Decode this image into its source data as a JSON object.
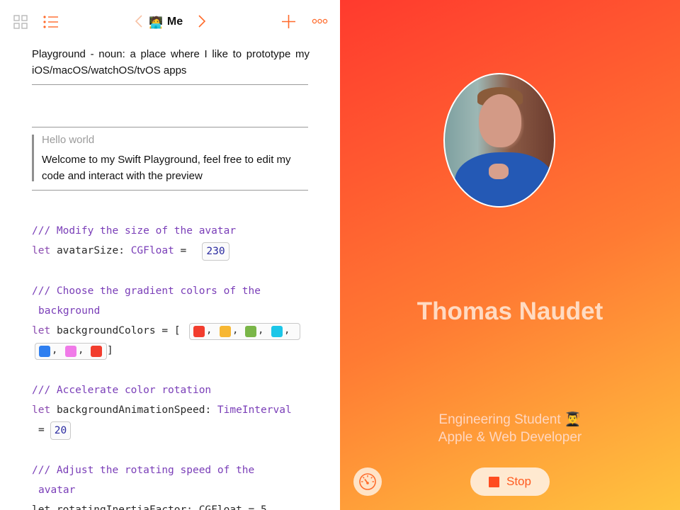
{
  "toolbar": {
    "title_emoji": "🧑‍💻",
    "title": "Me",
    "icons": [
      "grid-icon",
      "list-icon",
      "chevron-left-icon",
      "chevron-right-icon",
      "plus-icon",
      "more-icon"
    ],
    "accent": "#ff6a2a"
  },
  "doc": {
    "intro": "Playground - noun: a place where I like to prototype my iOS/macOS/watchOS/tvOS apps",
    "quote_title": "Hello world",
    "quote_body": "Welcome to my Swift Playground, feel free to edit my code and interact with the preview"
  },
  "code": {
    "kw_let": "let",
    "eq": "=",
    "comment1": "/// Modify the size of the avatar",
    "line1_name": "avatarSize:",
    "line1_type": "CGFloat",
    "line1_value": "230",
    "comment2a": "/// Choose the gradient colors of the",
    "comment2b": "background",
    "line2_name": "backgroundColors",
    "line2_open": "= [",
    "line2_close": "]",
    "colors_row1": [
      "#f23d2e",
      "#f7b733",
      "#7ab648",
      "#1cc6e8"
    ],
    "colors_row2": [
      "#2f7ff0",
      "#f07ae8",
      "#f23d2e"
    ],
    "comment3": "/// Accelerate color rotation",
    "line3_name": "backgroundAnimationSpeed:",
    "line3_type": "TimeInterval",
    "line3_value": "20",
    "comment4a": "/// Adjust the rotating speed of the",
    "comment4b": "avatar",
    "line4_partial": "let rotatingInertiaFactor: CGFloat = 5"
  },
  "preview": {
    "name": "Thomas Naudet",
    "subtitle_line1": "Engineering Student",
    "subtitle_emoji": "👨‍🎓",
    "subtitle_line2": "Apple & Web Developer",
    "stop_label": "Stop",
    "gradient_colors": [
      "#ff3a2e",
      "#ff7b33",
      "#ffc43f"
    ]
  }
}
